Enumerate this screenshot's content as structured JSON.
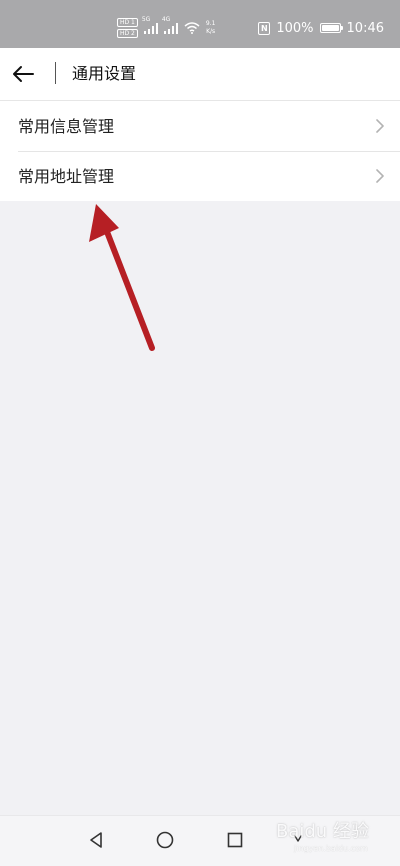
{
  "status_bar": {
    "sim1": "HD 1",
    "sim2": "HD 2",
    "signal1_tag": "5G",
    "signal2_tag": "4G",
    "speed_value": "9.1",
    "speed_unit": "K/s",
    "battery": "100%",
    "time": "10:46"
  },
  "header": {
    "title": "通用设置"
  },
  "list": {
    "items": [
      {
        "label": "常用信息管理"
      },
      {
        "label": "常用地址管理"
      }
    ]
  },
  "watermark": {
    "main": "Baidu 经验",
    "sub": "jingyan.baidu.com"
  }
}
